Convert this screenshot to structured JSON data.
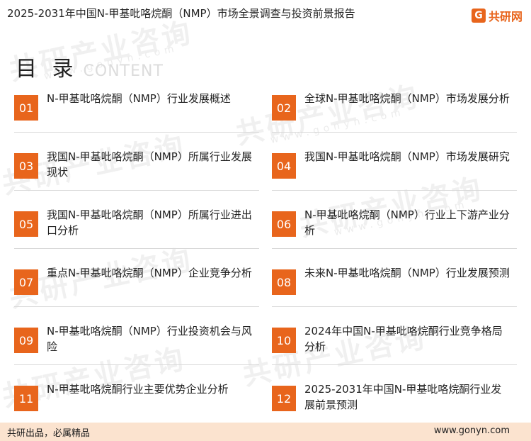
{
  "colors": {
    "accent": "#e8651c",
    "footer_bg": "#fbe3cf"
  },
  "header": {
    "title": "2025-2031年中国N-甲基吡咯烷酮（NMP）市场全景调查与投资前景报告",
    "brand_icon": "gonyn-logo-icon",
    "brand_name": "共研网"
  },
  "toc": {
    "title": "目 录",
    "subtitle": "CONTENT",
    "items": [
      {
        "num": "01",
        "text": "N-甲基吡咯烷酮（NMP）行业发展概述"
      },
      {
        "num": "02",
        "text": "全球N-甲基吡咯烷酮（NMP）市场发展分析"
      },
      {
        "num": "03",
        "text": "我国N-甲基吡咯烷酮（NMP）所属行业发展现状"
      },
      {
        "num": "04",
        "text": "我国N-甲基吡咯烷酮（NMP）市场发展研究"
      },
      {
        "num": "05",
        "text": "我国N-甲基吡咯烷酮（NMP）所属行业进出口分析"
      },
      {
        "num": "06",
        "text": "N-甲基吡咯烷酮（NMP）行业上下游产业分析"
      },
      {
        "num": "07",
        "text": "重点N-甲基吡咯烷酮（NMP）企业竞争分析"
      },
      {
        "num": "08",
        "text": "未来N-甲基吡咯烷酮（NMP）行业发展预测"
      },
      {
        "num": "09",
        "text": "N-甲基吡咯烷酮（NMP）行业投资机会与风险"
      },
      {
        "num": "10",
        "text": "2024年中国N-甲基吡咯烷酮行业竞争格局分析"
      },
      {
        "num": "11",
        "text": "N-甲基吡咯烷酮行业主要优势企业分析"
      },
      {
        "num": "12",
        "text": "2025-2031年中国N-甲基吡咯烷酮行业发展前景预测"
      }
    ]
  },
  "watermark": {
    "text": "共研产业咨询",
    "url": "www.gonyn.com"
  },
  "footer": {
    "slogan": "共研出品，必属精品",
    "website": "www.gonyn.com"
  }
}
